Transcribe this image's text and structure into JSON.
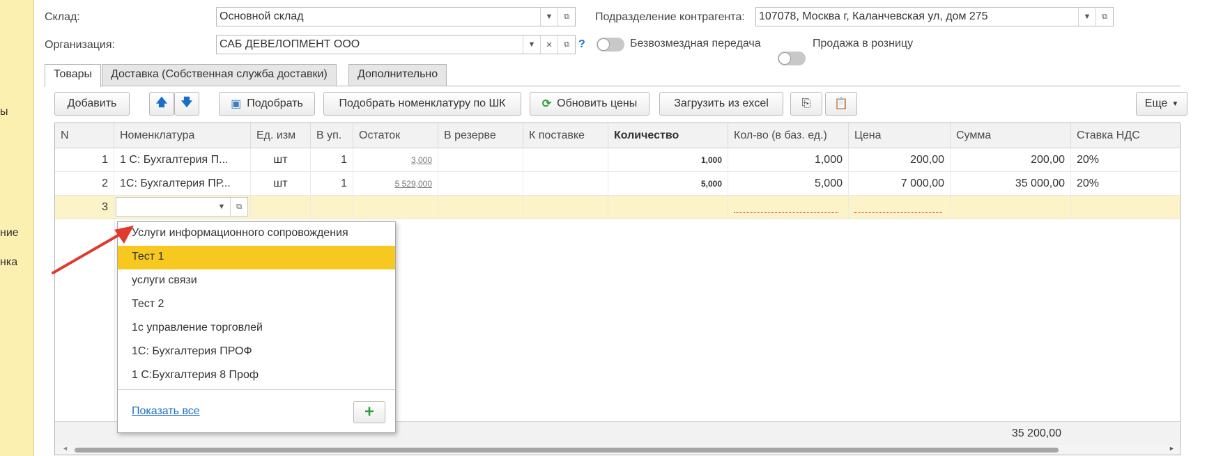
{
  "left_panel": {
    "fragments": [
      "ы",
      "ние",
      "нка"
    ]
  },
  "header": {
    "warehouse": {
      "label": "Склад:",
      "value": "Основной склад"
    },
    "organization": {
      "label": "Организация:",
      "value": "САБ ДЕВЕЛОПМЕНТ ООО",
      "help": "?"
    },
    "division": {
      "label": "Подразделение контрагента:",
      "value": "107078, Москва г, Каланчевская ул, дом 275"
    },
    "toggles": [
      {
        "label": "Безвозмездная передача",
        "on": false
      },
      {
        "label": "Продажа в розницу",
        "on": false
      }
    ]
  },
  "tabs": [
    {
      "label": "Товары",
      "active": true
    },
    {
      "label": "Доставка (Собственная служба доставки)",
      "active": false
    },
    {
      "label": "Дополнительно",
      "active": false
    }
  ],
  "toolbar": {
    "add": "Добавить",
    "pick": "Подобрать",
    "pick_barcode": "Подобрать номенклатуру по ШК",
    "update_prices": "Обновить цены",
    "load_excel": "Загрузить из excel",
    "more": "Еще"
  },
  "table": {
    "columns": [
      "N",
      "Номенклатура",
      "Ед. изм",
      "В уп.",
      "Остаток",
      "В резерве",
      "К поставке",
      "Количество",
      "Кол-во (в баз. ед.)",
      "Цена",
      "Сумма",
      "Ставка НДС"
    ],
    "rows": [
      {
        "n": "1",
        "item": "1 С:  Бухгалтерия П...",
        "unit": "шт",
        "pack": "1",
        "stock": "3,000",
        "reserve": "",
        "supply": "",
        "qty": "1,000",
        "qty_base": "1,000",
        "price": "200,00",
        "sum": "200,00",
        "vat": "20%"
      },
      {
        "n": "2",
        "item": "1С: Бухгалтерия ПР...",
        "unit": "шт",
        "pack": "1",
        "stock": "5 529,000",
        "reserve": "",
        "supply": "",
        "qty": "5,000",
        "qty_base": "5,000",
        "price": "7 000,00",
        "sum": "35 000,00",
        "vat": "20%"
      },
      {
        "n": "3",
        "item": "",
        "unit": "",
        "pack": "",
        "stock": "",
        "reserve": "",
        "supply": "",
        "qty": "",
        "qty_base": "",
        "price": "",
        "sum": "",
        "vat": ""
      }
    ],
    "total_sum": "35 200,00"
  },
  "dropdown": {
    "items": [
      "Услуги информационного сопровождения",
      "Тест 1",
      "услуги связи",
      "Тест 2",
      "1с управление торговлей",
      "1С: Бухгалтерия ПРОФ",
      "1 С:Бухгалтерия 8 Проф"
    ],
    "highlighted_index": 1,
    "show_all": "Показать все",
    "add_symbol": "+"
  },
  "colors": {
    "highlight": "#f7c820",
    "selected_row": "#fcf3c9",
    "arrow": "#e03a2f",
    "link": "#1a6ec8"
  }
}
